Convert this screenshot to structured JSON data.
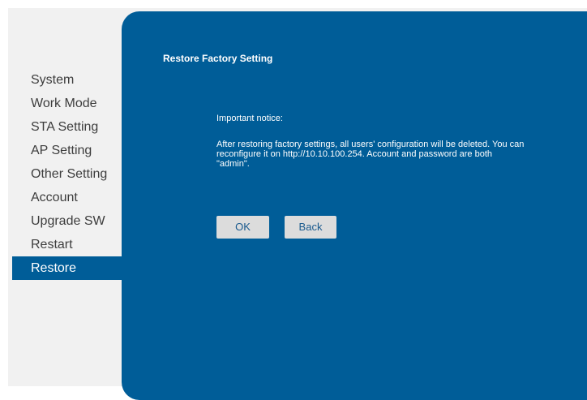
{
  "sidebar": {
    "items": [
      {
        "label": "System"
      },
      {
        "label": "Work Mode"
      },
      {
        "label": "STA Setting"
      },
      {
        "label": "AP Setting"
      },
      {
        "label": "Other Setting"
      },
      {
        "label": "Account"
      },
      {
        "label": "Upgrade SW"
      },
      {
        "label": "Restart"
      },
      {
        "label": "Restore",
        "active": true
      }
    ]
  },
  "panel": {
    "title": "Restore Factory Setting",
    "notice_heading": "Important notice:",
    "notice_body": "After restoring factory settings, all users' configuration will be deleted. You can reconfigure it on http://10.10.100.254. Account and password are both \"admin\".",
    "ok_label": "OK",
    "back_label": "Back"
  },
  "colors": {
    "panel_background": "#005d98",
    "active_nav_background": "#005d98",
    "page_background": "#f1f1f1",
    "button_background": "#dcdcdc",
    "button_text": "#1a5a8e"
  }
}
